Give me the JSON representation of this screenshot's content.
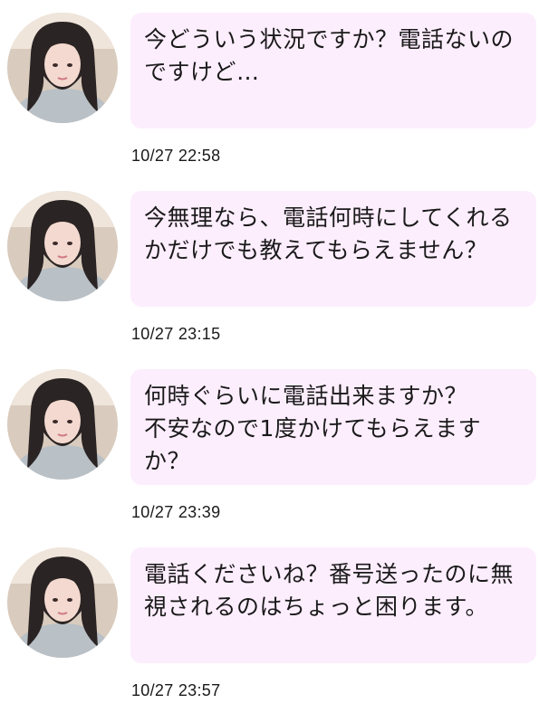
{
  "conversation": {
    "messages": [
      {
        "avatar_icon": "user-avatar-photo",
        "text": "今どういう状況ですか？電話ないのですけど…",
        "timestamp": "10/27 22:58"
      },
      {
        "avatar_icon": "user-avatar-photo",
        "text": "今無理なら、電話何時にしてくれるかだけでも教えてもらえません？",
        "timestamp": "10/27 23:15"
      },
      {
        "avatar_icon": "user-avatar-photo",
        "text": "何時ぐらいに電話出来ますか？\n不安なので1度かけてもらえますか？",
        "timestamp": "10/27 23:39"
      },
      {
        "avatar_icon": "user-avatar-photo",
        "text": "電話くださいね？番号送ったのに無視されるのはちょっと困ります。",
        "timestamp": "10/27 23:57"
      }
    ]
  },
  "colors": {
    "bubble_background": "#fdeefe",
    "text": "#1a1a1a",
    "page_background": "#ffffff"
  }
}
